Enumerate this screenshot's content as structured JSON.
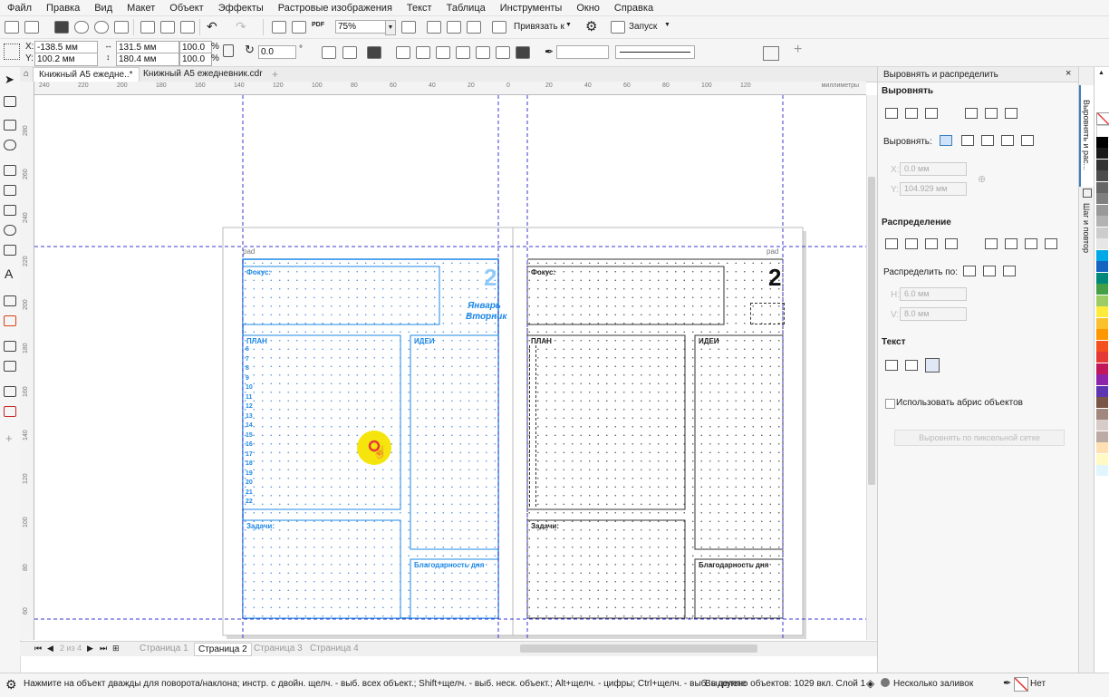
{
  "menu": [
    "Файл",
    "Правка",
    "Вид",
    "Макет",
    "Объект",
    "Эффекты",
    "Растровые изображения",
    "Текст",
    "Таблица",
    "Инструменты",
    "Окно",
    "Справка"
  ],
  "toolbar": {
    "pdf_label": "PDF",
    "zoom": "75%",
    "snap_label": "Привязать к",
    "launch_label": "Запуск"
  },
  "propbar": {
    "x_label": "X:",
    "x_value": "-138.5 мм",
    "y_label": "Y:",
    "y_value": "100.2 мм",
    "w_value": "131.5 мм",
    "h_value": "180.4 мм",
    "sx_value": "100.0",
    "sy_value": "100.0",
    "pct": "%",
    "angle_value": "0.0",
    "degree": "°"
  },
  "tabs": [
    "Книжный А5 ежедне..*",
    "Книжный А5 ежедневник.cdr"
  ],
  "ruler": {
    "units": "миллиметры",
    "h_numbers": [
      "240",
      "220",
      "200",
      "180",
      "160",
      "140",
      "120",
      "100",
      "80",
      "60",
      "40",
      "20",
      "0",
      "20",
      "40",
      "60",
      "80",
      "100",
      "120"
    ],
    "v_numbers": [
      "280",
      "260",
      "240",
      "220",
      "200",
      "180",
      "160",
      "140",
      "120",
      "100",
      "80",
      "60"
    ]
  },
  "page_left": {
    "top_label": "pad",
    "big_number": "2",
    "month": "Январь",
    "weekday": "Вторник",
    "box_focus": "Фокус:",
    "box_plan": "ПЛАН",
    "box_ideas": "ИДЕИ",
    "box_tasks": "Задачи:",
    "box_grat": "Благодарность дня",
    "hours": [
      "6",
      "7",
      "8",
      "9",
      "10",
      "11",
      "12",
      "13",
      "14",
      "15",
      "16",
      "17",
      "18",
      "19",
      "20",
      "21",
      "22"
    ]
  },
  "page_right": {
    "top_label": "pad",
    "big_number": "2",
    "box_focus": "Фокус:",
    "box_plan": "ПЛАН",
    "box_ideas": "ИДЕИ",
    "box_tasks": "Задачи:",
    "box_grat": "Благодарность дня"
  },
  "page_nav": {
    "counter": "2 из 4",
    "pages": [
      "Страница 1",
      "Страница 2",
      "Страница 3",
      "Страница 4"
    ]
  },
  "status": {
    "hint": "Нажмите на объект дважды для поворота/наклона; инстр. с двойн. щелч. - выб. всех объект.; Shift+щелч. - выб. неск. объект.; Alt+щелч. - цифры; Ctrl+щелч. - выб. в группе",
    "selection": "Выделено объектов: 1029 вкл. Слой 1",
    "fill": "Несколько заливок",
    "outline": "Нет"
  },
  "docker": {
    "title": "Выровнять и распределить",
    "align_header": "Выровнять",
    "align_to_label": "Выровнять:",
    "x_label": "X:",
    "x_value": "0.0 мм",
    "y_label": "Y:",
    "y_value": "104.929 мм",
    "distribute_header": "Распределение",
    "distribute_to_label": "Распределить по:",
    "h_label": "H:",
    "h_value": "6.0 мм",
    "v_label": "V:",
    "v_value": "8.0 мм",
    "text_header": "Текст",
    "outline_checkbox": "Использовать абрис объектов",
    "pixel_grid_button": "Выровнять по пиксельной сетке"
  },
  "side_tabs": [
    "Выровнять и рас...",
    "Шаг и повтор"
  ],
  "palette": [
    "#ffffff",
    "#000000",
    "#1a1a1a",
    "#333333",
    "#4d4d4d",
    "#666666",
    "#808080",
    "#999999",
    "#b3b3b3",
    "#cccccc",
    "#e6e6e6",
    "#00a8e8",
    "#1565c0",
    "#00897b",
    "#43a047",
    "#9ccc65",
    "#ffeb3b",
    "#fbc02d",
    "#ff9800",
    "#f4511e",
    "#e53935",
    "#c2185b",
    "#8e24aa",
    "#5e35b1",
    "#795548",
    "#a1887f",
    "#d7ccc8",
    "#bcaaa4",
    "#ffe0b2",
    "#fff9c4",
    "#e1f5fe"
  ]
}
